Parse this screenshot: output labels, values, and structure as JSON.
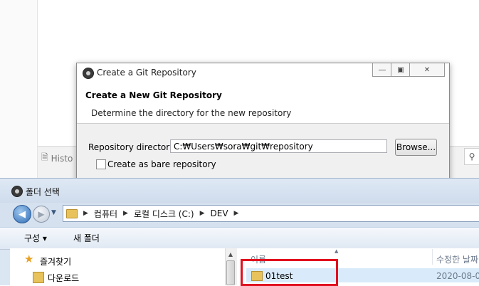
{
  "background": {
    "history_tab_label": "Histo"
  },
  "git_dialog": {
    "title": "Create a Git Repository",
    "heading": "Create a New Git Repository",
    "description": "Determine the directory for the new repository",
    "repo_dir_label": "Repository directory:",
    "repo_dir_value": "C:₩Users₩sora₩git₩repository",
    "browse_label": "Browse...",
    "bare_label": "Create as bare repository",
    "bare_checked": false
  },
  "folder_dialog": {
    "title": "폴더 선택",
    "breadcrumb": [
      "컴퓨터",
      "로컬 디스크 (C:)",
      "DEV"
    ],
    "toolbar": {
      "organize_label": "구성 ▾",
      "new_folder_label": "새 폴더"
    },
    "nav": {
      "favorites_label": "즐겨찾기",
      "downloads_label": "다운로드"
    },
    "columns": {
      "name": "이름",
      "date": "수정한 날짜"
    },
    "rows": [
      {
        "name": "01test",
        "date": "2020-08-0"
      }
    ]
  },
  "colors": {
    "highlight_box": "#e0101e",
    "row_selected": "#d9ebfb"
  }
}
